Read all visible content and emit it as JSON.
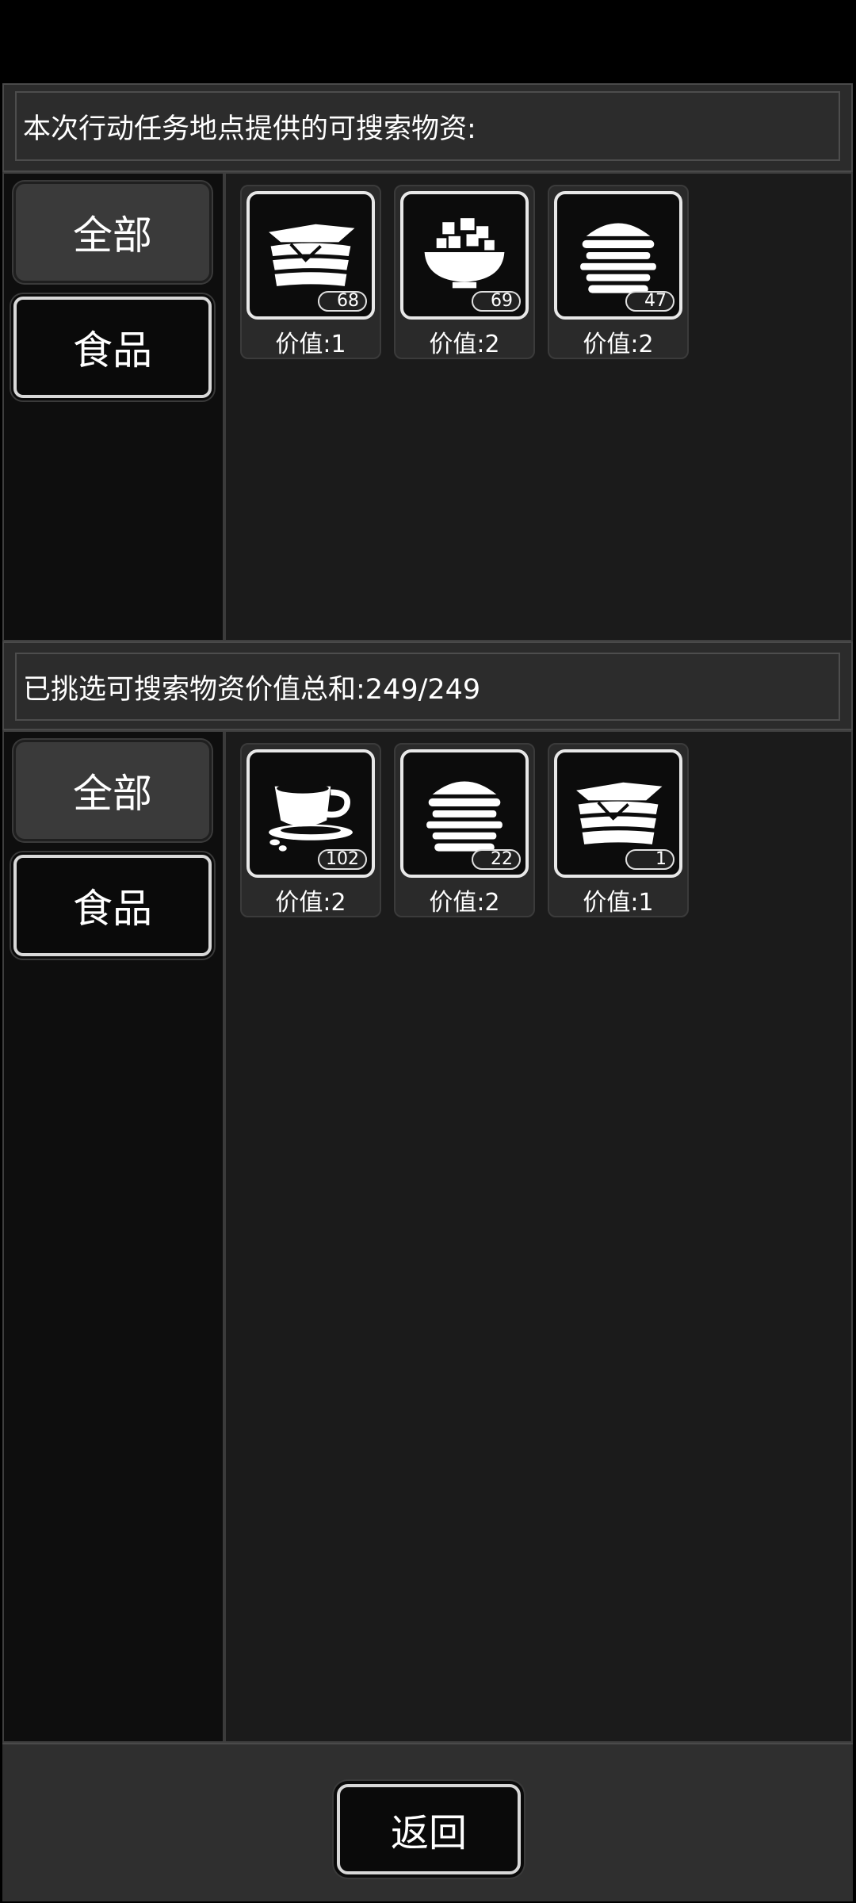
{
  "top_section": {
    "title": "本次行动任务地点提供的可搜索物资:",
    "categories": {
      "all": "全部",
      "food": "食品"
    },
    "items": [
      {
        "icon": "sandwich-icon",
        "count": "68",
        "value": "价值:1"
      },
      {
        "icon": "bowl-food-icon",
        "count": "69",
        "value": "价值:2"
      },
      {
        "icon": "burger-icon",
        "count": "47",
        "value": "价值:2"
      }
    ]
  },
  "bottom_section": {
    "title": "已挑选可搜索物资价值总和:249/249",
    "categories": {
      "all": "全部",
      "food": "食品"
    },
    "items": [
      {
        "icon": "coffee-cup-icon",
        "count": "102",
        "value": "价值:2"
      },
      {
        "icon": "burger-icon",
        "count": "22",
        "value": "价值:2"
      },
      {
        "icon": "sandwich-icon",
        "count": "1",
        "value": "价值:1"
      }
    ]
  },
  "footer": {
    "back_label": "返回"
  },
  "colors": {
    "background": "#000000",
    "panel": "#1b1b1b",
    "frame": "#2b2b2b",
    "text": "#ffffff"
  }
}
